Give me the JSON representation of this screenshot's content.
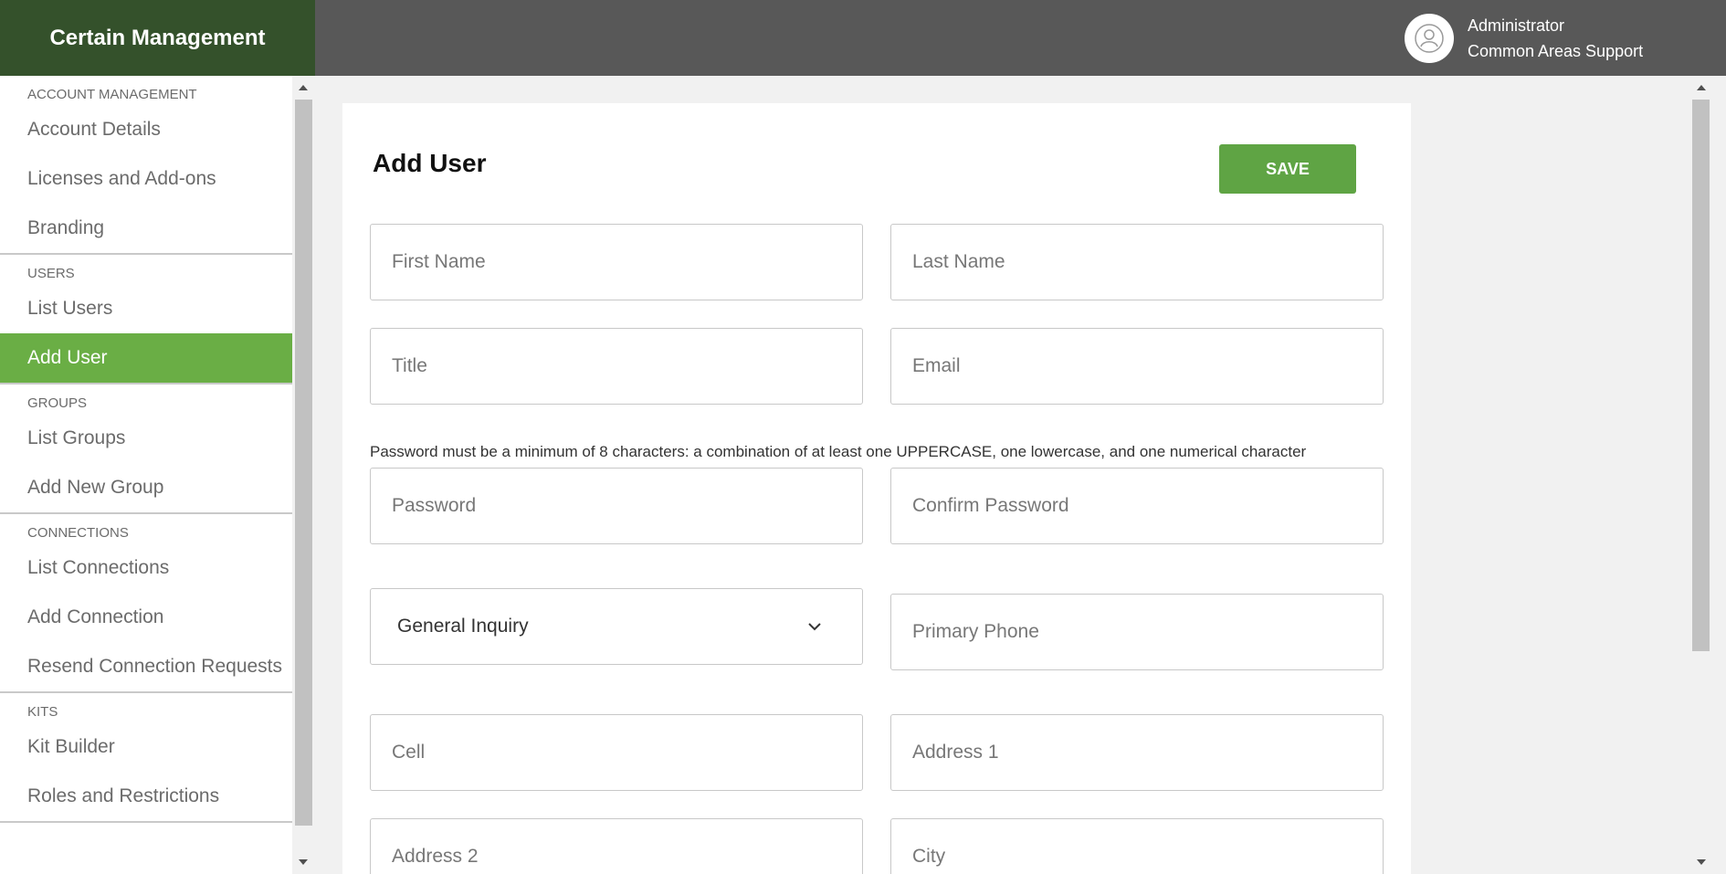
{
  "header": {
    "brand": "Certain Management",
    "user_name": "Administrator",
    "user_org": "Common Areas Support"
  },
  "sidebar": {
    "sections": [
      {
        "label": "ACCOUNT MANAGEMENT",
        "items": [
          "Account Details",
          "Licenses and Add-ons",
          "Branding"
        ]
      },
      {
        "label": "USERS",
        "items": [
          "List Users",
          "Add User"
        ]
      },
      {
        "label": "GROUPS",
        "items": [
          "List Groups",
          "Add New Group"
        ]
      },
      {
        "label": "CONNECTIONS",
        "items": [
          "List Connections",
          "Add Connection",
          "Resend Connection Requests"
        ]
      },
      {
        "label": "KITS",
        "items": [
          "Kit Builder",
          "Roles and Restrictions"
        ]
      }
    ],
    "active_item": "Add User"
  },
  "form": {
    "title": "Add User",
    "save_label": "SAVE",
    "first_name_placeholder": "First Name",
    "last_name_placeholder": "Last Name",
    "title_placeholder": "Title",
    "email_placeholder": "Email",
    "password_hint": "Password must be a minimum of 8 characters: a combination of at least one UPPERCASE, one lowercase, and one numerical character",
    "password_placeholder": "Password",
    "confirm_password_placeholder": "Confirm Password",
    "inquiry_selected": "General Inquiry",
    "primary_phone_placeholder": "Primary Phone",
    "cell_placeholder": "Cell",
    "address1_placeholder": "Address 1",
    "address2_placeholder": "Address 2",
    "city_placeholder": "City"
  },
  "colors": {
    "brand_bg": "#34512b",
    "header_bg": "#585858",
    "active_nav": "#6aae45",
    "save_button": "#5fa444"
  }
}
